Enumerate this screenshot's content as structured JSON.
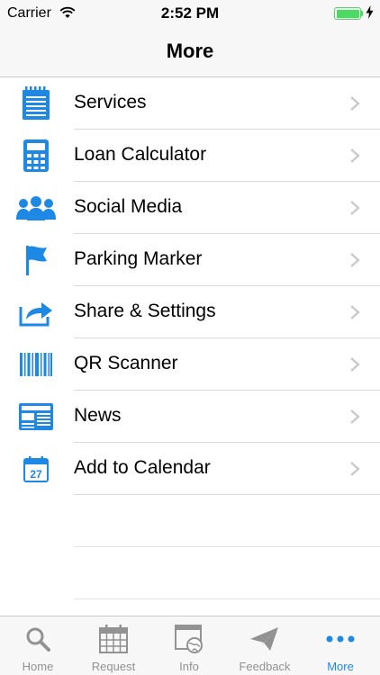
{
  "status_bar": {
    "carrier": "Carrier",
    "time": "2:52 PM"
  },
  "nav": {
    "title": "More"
  },
  "menu": {
    "items": [
      {
        "label": "Services",
        "icon": "notepad-icon"
      },
      {
        "label": "Loan Calculator",
        "icon": "calculator-icon"
      },
      {
        "label": "Social Media",
        "icon": "group-icon"
      },
      {
        "label": "Parking Marker",
        "icon": "flag-icon"
      },
      {
        "label": "Share & Settings",
        "icon": "share-icon"
      },
      {
        "label": "QR Scanner",
        "icon": "barcode-icon"
      },
      {
        "label": "News",
        "icon": "newspaper-icon"
      },
      {
        "label": "Add to Calendar",
        "icon": "calendar-icon",
        "icon_text": "27"
      }
    ]
  },
  "tab_bar": {
    "tabs": [
      {
        "label": "Home",
        "icon": "search-icon"
      },
      {
        "label": "Request",
        "icon": "calendar-grid-icon"
      },
      {
        "label": "Info",
        "icon": "browser-globe-icon"
      },
      {
        "label": "Feedback",
        "icon": "paper-plane-icon"
      },
      {
        "label": "More",
        "icon": "more-dots-icon",
        "active": true
      }
    ]
  },
  "colors": {
    "accent": "#1e88e5",
    "inactive": "#929292",
    "battery": "#4cd964"
  }
}
